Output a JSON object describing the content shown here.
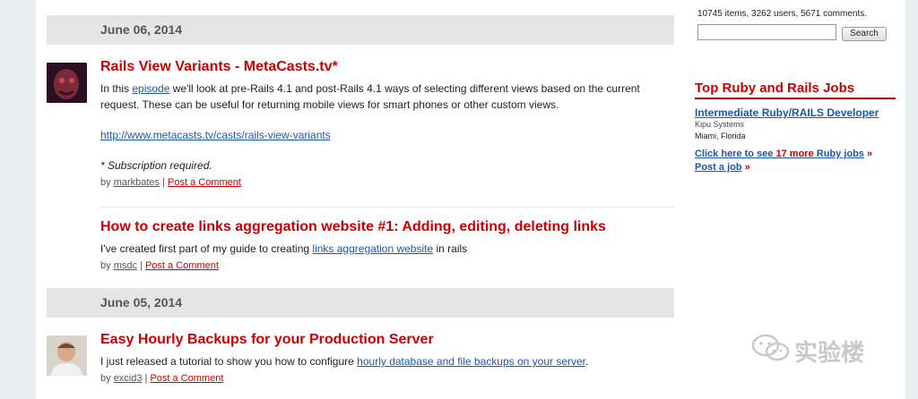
{
  "stats": "10745 items, 3262 users, 5671 comments.",
  "search": {
    "button_label": "Search",
    "placeholder": ""
  },
  "dates": [
    "June 06, 2014",
    "June 05, 2014"
  ],
  "posts": [
    {
      "title": "Rails View Variants - MetaCasts.tv*",
      "body_before": "In this ",
      "body_link": "episode",
      "body_after": " we'll look at pre-Rails 4.1 and post-Rails 4.1 ways of selecting different views based on the current request. These can be useful for returning mobile views for smart phones or other custom views.",
      "url": "http://www.metacasts.tv/casts/rails-view-variants",
      "note": "* Subscription required.",
      "by": "by ",
      "author": "markbates",
      "comment_label": "Post a Comment"
    },
    {
      "title": "How to create links aggregation website #1: Adding, editing, deleting links",
      "body_before": "I've created first part of my guide to creating ",
      "body_link": "links aggregation website",
      "body_after": " in rails",
      "by": "by ",
      "author": "msdc",
      "comment_label": "Post a Comment"
    },
    {
      "title": "Easy Hourly Backups for your Production Server",
      "body_before": "I just released a tutorial to show you how to configure ",
      "body_link": "hourly database and file backups on your server",
      "body_after": ".",
      "by": "by ",
      "author": "excid3",
      "comment_label": "Post a Comment"
    }
  ],
  "jobs": {
    "title": "Top Ruby and Rails Jobs",
    "job_title": "Intermediate Ruby/RAILS Developer",
    "company": "Kipu Systems",
    "location": "Miami, Florida",
    "more_prefix": "Click here to see ",
    "more_count": "17 more",
    "more_suffix": " Ruby jobs",
    "post_job": "Post a job",
    "arrow": "»"
  },
  "watermark": "实验楼",
  "icons": [
    "avatar",
    "wechat-logo-icon"
  ],
  "colors": {
    "accent_red": "#cc0000",
    "link_blue": "#1b56b4",
    "date_bar": "#e5e5e5",
    "page_bg": "#e9eef3"
  }
}
